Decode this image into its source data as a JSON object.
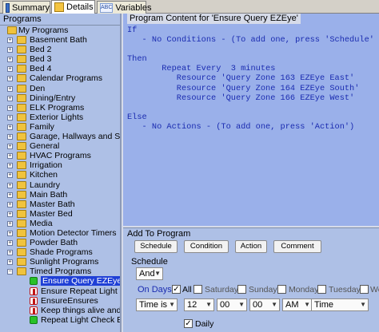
{
  "tabs": [
    {
      "label": "Summary",
      "icon": "summary-icon"
    },
    {
      "label": "Details",
      "icon": "details-icon",
      "active": true
    },
    {
      "label": "Variables",
      "icon": "variables-icon",
      "badge": "ABC"
    }
  ],
  "left_panel": {
    "header": "Programs",
    "root": "My Programs",
    "folders": [
      "Basement Bath",
      "Bed 2",
      "Bed 3",
      "Bed 4",
      "Calendar Programs",
      "Den",
      "Dining/Entry",
      "ELK Programs",
      "Exterior Lights",
      "Family",
      "Garage, Hallways and Stair",
      "General",
      "HVAC Programs",
      "Irrigation",
      "Kitchen",
      "Laundry",
      "Main Bath",
      "Master Bath",
      "Master Bed",
      "Media",
      "Motion Detector Timers",
      "Powder Bath",
      "Shade Programs",
      "Sunlight Programs",
      "Timed Programs"
    ],
    "timed_children": [
      {
        "label": "Ensure Query EZEye",
        "status": "green",
        "selected": true
      },
      {
        "label": "Ensure Repeat Light Ch",
        "status": "red"
      },
      {
        "label": "EnsureEnsures",
        "status": "red"
      },
      {
        "label": "Keep things alive and ti",
        "status": "red"
      },
      {
        "label": "Repeat Light Check Eve",
        "status": "green"
      }
    ]
  },
  "content": {
    "title": "Program Content for 'Ensure Query EZEye'",
    "lines": [
      "If",
      "   - No Conditions - (To add one, press 'Schedule' or 'Condi",
      "",
      "Then",
      "       Repeat Every  3 minutes",
      "          Resource 'Query Zone 163 EZEye East'",
      "          Resource 'Query Zone 164 EZEye South'",
      "          Resource 'Query Zone 166 EZEye West'",
      "",
      "Else",
      "   - No Actions - (To add one, press 'Action')"
    ]
  },
  "add_to_program": {
    "title": "Add To Program",
    "buttons": [
      "Schedule",
      "Condition",
      "Action",
      "Comment"
    ],
    "schedule_title": "Schedule",
    "logic_select": "And",
    "on_days_label": "On Days:",
    "days": [
      {
        "label": "All",
        "checked": true
      },
      {
        "label": "Saturday",
        "checked": false
      },
      {
        "label": "Sunday",
        "checked": false
      },
      {
        "label": "Monday",
        "checked": false
      },
      {
        "label": "Tuesday",
        "checked": false
      },
      {
        "label": "We",
        "checked": false
      }
    ],
    "time_mode": "Time is",
    "hour": "12",
    "minute": "00",
    "second": "00",
    "ampm": "AM",
    "time_type": "Time",
    "daily_label": "Daily",
    "daily_checked": true
  },
  "colors": {
    "content_bg": "#9ab0ea",
    "code_text": "#1a2bb0",
    "selection": "#1f3fd6",
    "folder": "#f0c33d"
  }
}
